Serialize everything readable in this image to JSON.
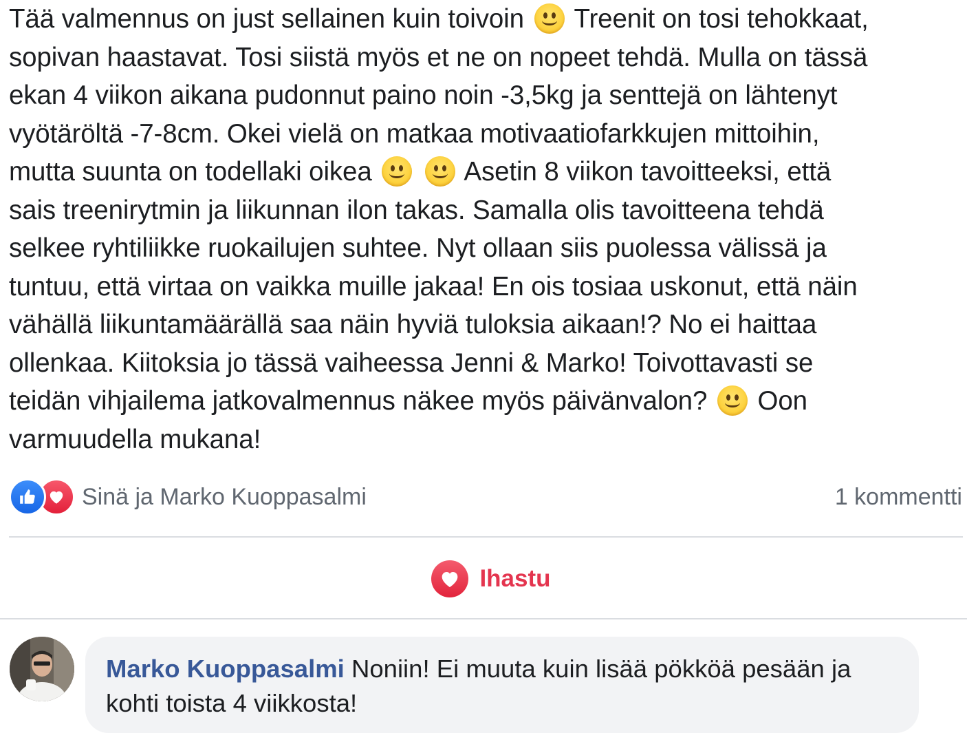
{
  "post": {
    "lines": [
      [
        "Tää valmennus on just sellainen kuin toivoin",
        "Treenit on tosi tehokkaat,"
      ],
      [
        "sopivan haastavat. Tosi siistä myös et ne on nopeet tehdä. Mulla on tässä"
      ],
      [
        "ekan 4 viikon aikana pudonnut paino noin -3,5kg ja senttejä on lähtenyt"
      ],
      [
        "vyötäröltä -7-8cm. Okei vielä on matkaa motivaatiofarkkujen mittoihin,"
      ],
      [
        "mutta suunta on todellaki oikea",
        "",
        "Asetin 8 viikon tavoitteeksi, että"
      ],
      [
        "sais treenirytmin ja liikunnan ilon takas. Samalla olis tavoitteena tehdä"
      ],
      [
        "selkee ryhtiliikke ruokailujen suhtee. Nyt ollaan siis puolessa välissä ja"
      ],
      [
        "tuntuu, että virtaa on vaikka muille jakaa! En ois tosiaa uskonut, että näin"
      ],
      [
        "vähällä liikuntamäärällä saa näin hyviä tuloksia aikaan!? No ei haittaa"
      ],
      [
        "ollenkaa. Kiitoksia jo tässä vaiheessa Jenni & Marko! Toivottavasti se"
      ],
      [
        "teidän vihjailema jatkovalmennus näkee myös päivänvalon?",
        "Oon"
      ],
      [
        "varmuudella mukana!"
      ]
    ]
  },
  "reactions": {
    "names": "Sinä ja Marko Kuoppasalmi",
    "comment_count": "1 kommentti",
    "icons": [
      "thumbs-up-icon",
      "heart-icon"
    ]
  },
  "actions": {
    "love_label": "Ihastu",
    "love_color": "#e4354f"
  },
  "comment": {
    "author": "Marko Kuoppasalmi",
    "text_line1": "Noniin! Ei muuta kuin lisää pökköä pesään ja",
    "text_line2": "kohti toista 4 viikkosta!"
  },
  "colors": {
    "link": "#385898",
    "muted": "#606770",
    "divider": "#dadde1",
    "bubble": "#f2f3f5"
  }
}
